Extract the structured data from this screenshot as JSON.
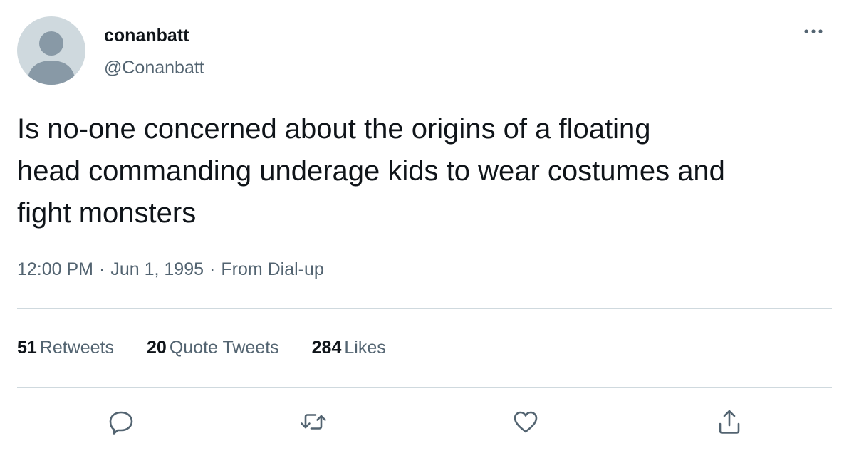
{
  "author": {
    "display_name": "conanbatt",
    "handle": "@Conanbatt"
  },
  "tweet": {
    "text": "Is no-one concerned about the origins of a floating\nhead commanding underage kids to wear costumes and\nfight monsters",
    "time": "12:00 PM",
    "date": "Jun 1, 1995",
    "source": "From Dial-up",
    "separator": "·"
  },
  "stats": {
    "retweets_count": "51",
    "retweets_label": "Retweets",
    "quotes_count": "20",
    "quotes_label": "Quote Tweets",
    "likes_count": "284",
    "likes_label": "Likes"
  },
  "actions": {
    "reply_icon": "reply-icon",
    "retweet_icon": "retweet-icon",
    "like_icon": "heart-icon",
    "share_icon": "share-icon"
  },
  "colors": {
    "text_primary": "#0f1419",
    "text_secondary": "#536471",
    "divider": "#cfd9de",
    "avatar_bg": "#cfd9de",
    "avatar_figure": "#8899a6"
  }
}
